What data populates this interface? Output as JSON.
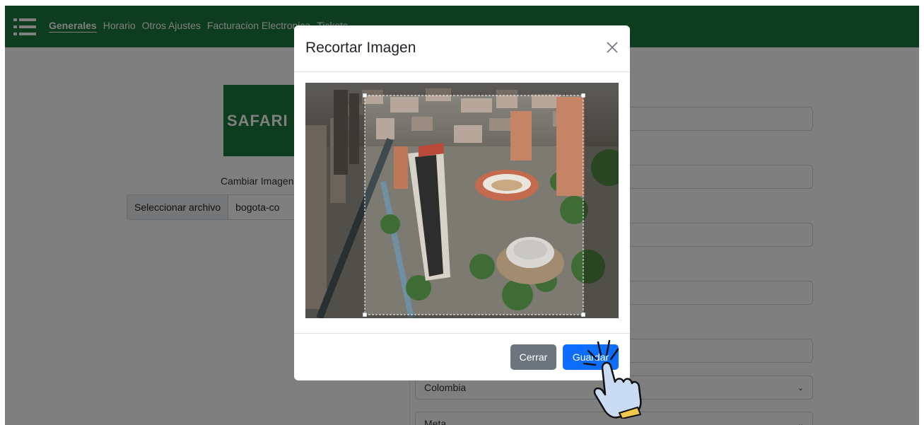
{
  "nav": {
    "tabs": [
      {
        "label": "Generales"
      },
      {
        "label": "Horario"
      },
      {
        "label": "Otros Ajustes"
      },
      {
        "label": "Facturacion Electronica"
      },
      {
        "label": "Tickets"
      }
    ]
  },
  "logo": {
    "text": "SAFARI"
  },
  "image_section": {
    "change_label": "Cambiar Imagen",
    "file_button": "Seleccionar archivo",
    "file_name": "bogota-co"
  },
  "form": {
    "country_value": "Colombia",
    "department_value": "Meta"
  },
  "modal": {
    "title": "Recortar Imagen",
    "close_label": "Cerrar",
    "save_label": "Guardar"
  },
  "colors": {
    "brand_green": "#1a7a3c",
    "primary_blue": "#0d6efd",
    "secondary_gray": "#6c757d"
  },
  "icons": [
    "menu-icon",
    "close-icon",
    "chevron-down-icon",
    "hand-pointer-icon"
  ]
}
